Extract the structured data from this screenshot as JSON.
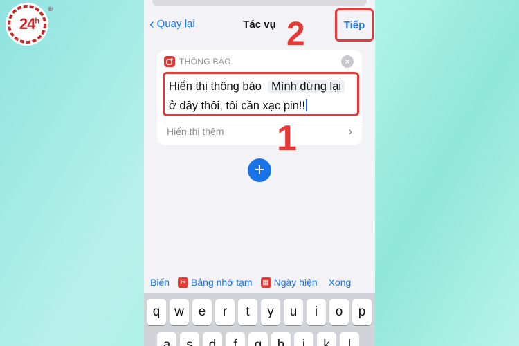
{
  "watermark": {
    "brand": "24",
    "suffix": "h",
    "registered": "®"
  },
  "nav": {
    "back_label": "Quay lại",
    "title": "Tác vụ",
    "next_label": "Tiếp"
  },
  "markers": {
    "step2": "2",
    "step1": "1"
  },
  "card": {
    "header": "THÔNG BÁO",
    "clear_icon": "x-circle-icon",
    "text_prefix": "Hiển thị thông báo",
    "token": "Mình dừng lại",
    "text_rest": "ở đây thôi, tôi cần xạc pin!!",
    "show_more": "Hiển thị thêm"
  },
  "add_button": "+",
  "variables": {
    "variable": "Biến",
    "clipboard": "Bảng nhớ tạm",
    "current_date": "Ngày hiện",
    "done": "Xong"
  },
  "keyboard": {
    "row1": [
      "q",
      "w",
      "e",
      "r",
      "t",
      "y",
      "u",
      "i",
      "o",
      "p"
    ],
    "row2": [
      "a",
      "s",
      "d",
      "f",
      "g",
      "h",
      "j",
      "k",
      "l"
    ]
  },
  "colors": {
    "accent": "#1a73e8",
    "highlight": "#e53935"
  }
}
